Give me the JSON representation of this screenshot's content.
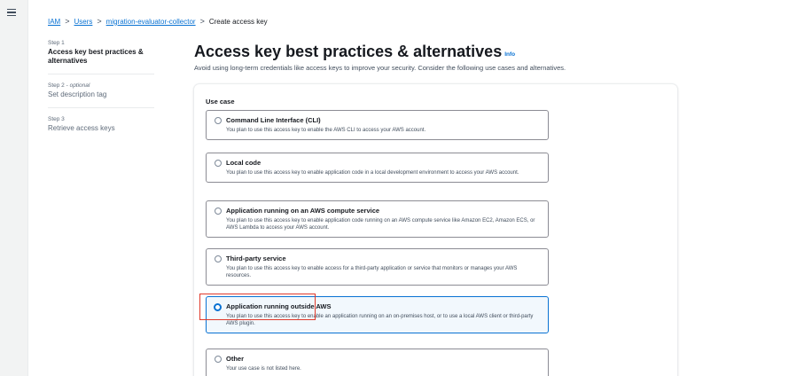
{
  "nav": {
    "menu_icon": "hamburger-menu-icon"
  },
  "breadcrumb": {
    "items": [
      "IAM",
      "Users",
      "migration-evaluator-collector"
    ],
    "current": "Create access key",
    "separator": ">"
  },
  "steps": [
    {
      "number": "Step 1",
      "optional": "",
      "title": "Access key best practices & alternatives"
    },
    {
      "number": "Step 2 - ",
      "optional": "optional",
      "title": "Set description tag"
    },
    {
      "number": "Step 3",
      "optional": "",
      "title": "Retrieve access keys"
    }
  ],
  "header": {
    "title": "Access key best practices & alternatives",
    "info": "Info",
    "description": "Avoid using long-term credentials like access keys to improve your security. Consider the following use cases and alternatives."
  },
  "form": {
    "use_case_label": "Use case",
    "options": [
      {
        "title": "Command Line Interface (CLI)",
        "description": "You plan to use this access key to enable the AWS CLI to access your AWS account."
      },
      {
        "title": "Local code",
        "description": "You plan to use this access key to enable application code in a local development environment to access your AWS account."
      },
      {
        "title": "Application running on an AWS compute service",
        "description": "You plan to use this access key to enable application code running on an AWS compute service like Amazon EC2, Amazon ECS, or AWS Lambda to access your AWS account."
      },
      {
        "title": "Third-party service",
        "description": "You plan to use this access key to enable access for a third-party application or service that monitors or manages your AWS resources."
      },
      {
        "title": "Application running outside AWS",
        "description": "You plan to use this access key to enable an application running on an on-premises host, or to use a local AWS client or third-party AWS plugin."
      },
      {
        "title": "Other",
        "description": "Your use case is not listed here."
      }
    ],
    "selected_option": "Application running outside AWS"
  },
  "colors": {
    "accent": "#0972d3",
    "highlight": "#e0392b",
    "background": "#f2f3f3"
  }
}
